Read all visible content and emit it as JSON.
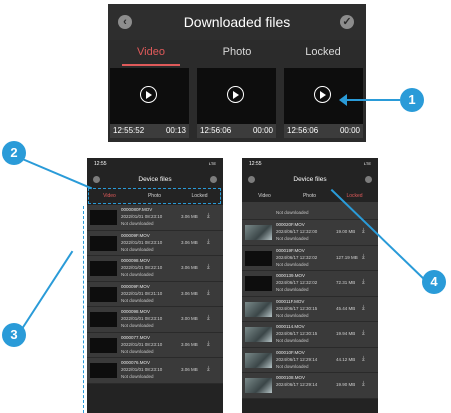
{
  "top_panel": {
    "title": "Downloaded files",
    "back_icon": "chevron-left-icon",
    "select_icon": "check-icon",
    "tabs": [
      "Video",
      "Photo",
      "Locked"
    ],
    "active_tab_color": "#e05a5a",
    "thumbnails": [
      {
        "time": "12:55:52",
        "duration": "00:13"
      },
      {
        "time": "12:56:06",
        "duration": "00:00"
      },
      {
        "time": "12:56:06",
        "duration": "00:00"
      }
    ]
  },
  "callouts": [
    "1",
    "2",
    "3",
    "4"
  ],
  "callout_color": "#2a9bd8",
  "left_phone": {
    "status_time": "12:55",
    "signal": "LTE",
    "title": "Device files",
    "tabs": [
      "Video",
      "Photo",
      "Locked"
    ],
    "rows": [
      {
        "name": "0000080F.MOV",
        "date": "2022/01/01 08:23:10",
        "size": "3.06 MB",
        "status": "Not downloaded"
      },
      {
        "name": "000009F.MOV",
        "date": "2022/01/01 08:23:10",
        "size": "3.06 MB",
        "status": "Not downloaded"
      },
      {
        "name": "0000098.MOV",
        "date": "2022/01/01 08:22:10",
        "size": "3.06 MB",
        "status": "Not downloaded"
      },
      {
        "name": "000009F.MOV",
        "date": "2022/01/01 08:21:10",
        "size": "3.06 MB",
        "status": "Not downloaded"
      },
      {
        "name": "0000098.MOV",
        "date": "2022/01/01 08:23:10",
        "size": "3.00 MB",
        "status": "Not downloaded"
      },
      {
        "name": "0000077.MOV",
        "date": "2022/01/01 08:23:10",
        "size": "3.06 MB",
        "status": "Not downloaded"
      },
      {
        "name": "0000076.MOV",
        "date": "2022/01/01 08:23:10",
        "size": "3.06 MB",
        "status": "Not downloaded"
      }
    ]
  },
  "right_phone": {
    "status_time": "12:55",
    "signal": "LTE",
    "title": "Device files",
    "tabs": [
      "Video",
      "Photo",
      "Locked"
    ],
    "rows": [
      {
        "name": "",
        "date": "",
        "size": "",
        "status": "Not downloaded"
      },
      {
        "name": "000020F.MOV",
        "date": "2024/06/17 12:32:00",
        "size": "19.00 MB",
        "status": "Not downloaded"
      },
      {
        "name": "000019F.MOV",
        "date": "2024/06/17 12:32:02",
        "size": "127.19 MB",
        "status": "Not downloaded"
      },
      {
        "name": "0000139.MOV",
        "date": "2024/06/17 12:32:02",
        "size": "72.31 MB",
        "status": "Not downloaded"
      },
      {
        "name": "000011F.MOV",
        "date": "2024/06/17 12:30:15",
        "size": "45.44 MB",
        "status": "Not downloaded"
      },
      {
        "name": "0000114.MOV",
        "date": "2024/06/17 12:30:15",
        "size": "19.94 MB",
        "status": "Not downloaded"
      },
      {
        "name": "000010F.MOV",
        "date": "2024/06/17 12:29:14",
        "size": "44.12 MB",
        "status": "Not downloaded"
      },
      {
        "name": "0000108.MOV",
        "date": "2024/06/17 12:29:14",
        "size": "19.90 MB",
        "status": ""
      }
    ]
  }
}
